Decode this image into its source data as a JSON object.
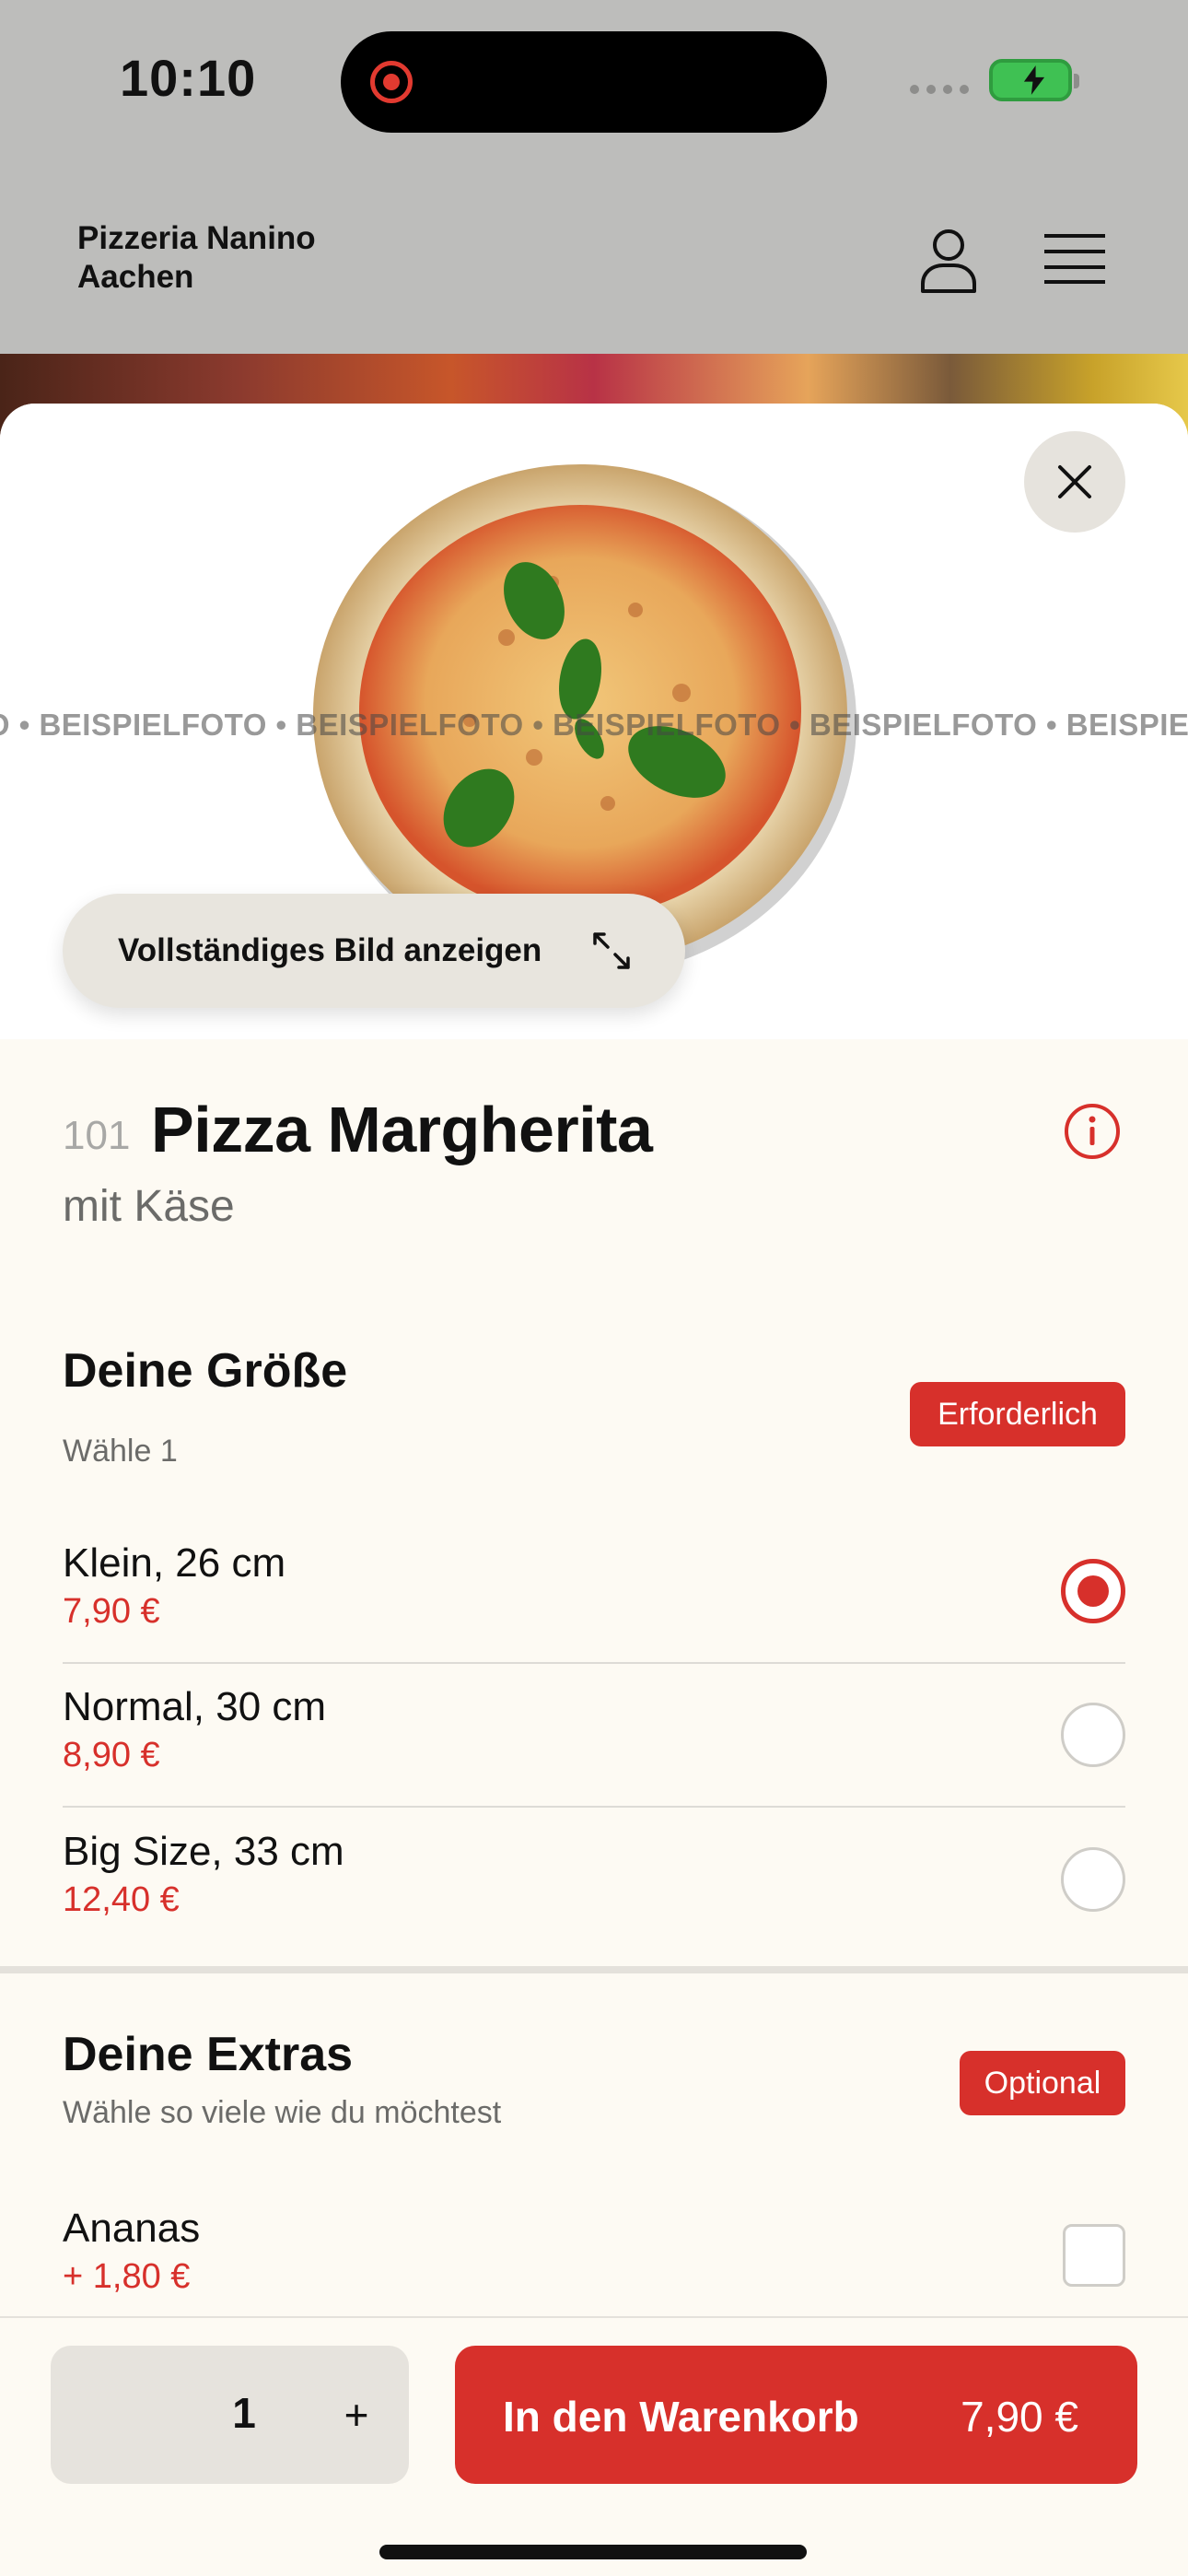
{
  "status_bar": {
    "time": "10:10",
    "recording": true,
    "battery_state": "charging",
    "battery_color": "#3fc153",
    "icons": [
      "recording-icon",
      "signal-icon",
      "battery-charging-icon"
    ]
  },
  "header": {
    "brand_line1": "Pizzeria Nanino",
    "brand_line2": "Aachen",
    "icons": [
      "user-icon",
      "hamburger-menu-icon"
    ]
  },
  "image": {
    "watermark": "FOTO • BEISPIELFOTO • BEISPIELFOTO • BEISPIELFOTO • BEISPIELFOTO • BEISPIELFOTO",
    "show_full_label": "Vollständiges Bild anzeigen",
    "icons": [
      "close-icon",
      "expand-icon"
    ]
  },
  "product": {
    "number": "101",
    "title": "Pizza Margherita",
    "subtitle": "mit Käse",
    "info_icon": "info-icon"
  },
  "size_group": {
    "title": "Deine Größe",
    "hint": "Wähle 1",
    "badge": "Erforderlich",
    "options": [
      {
        "name": "Klein, 26 cm",
        "price": "7,90 €",
        "selected": true
      },
      {
        "name": "Normal, 30 cm",
        "price": "8,90 €",
        "selected": false
      },
      {
        "name": "Big Size, 33 cm",
        "price": "12,40 €",
        "selected": false
      }
    ]
  },
  "extras_group": {
    "title": "Deine Extras",
    "hint": "Wähle so viele wie du möchtest",
    "badge": "Optional",
    "options": [
      {
        "name": "Ananas",
        "price": "+ 1,80 €",
        "checked": false
      }
    ]
  },
  "bottom_bar": {
    "quantity": "1",
    "plus_label": "+",
    "cart_label": "In den Warenkorb",
    "cart_price": "7,90 €"
  },
  "colors": {
    "accent": "#d7302b",
    "sheet_background": "#fdfaf3",
    "header_background": "#bdbdbb"
  }
}
